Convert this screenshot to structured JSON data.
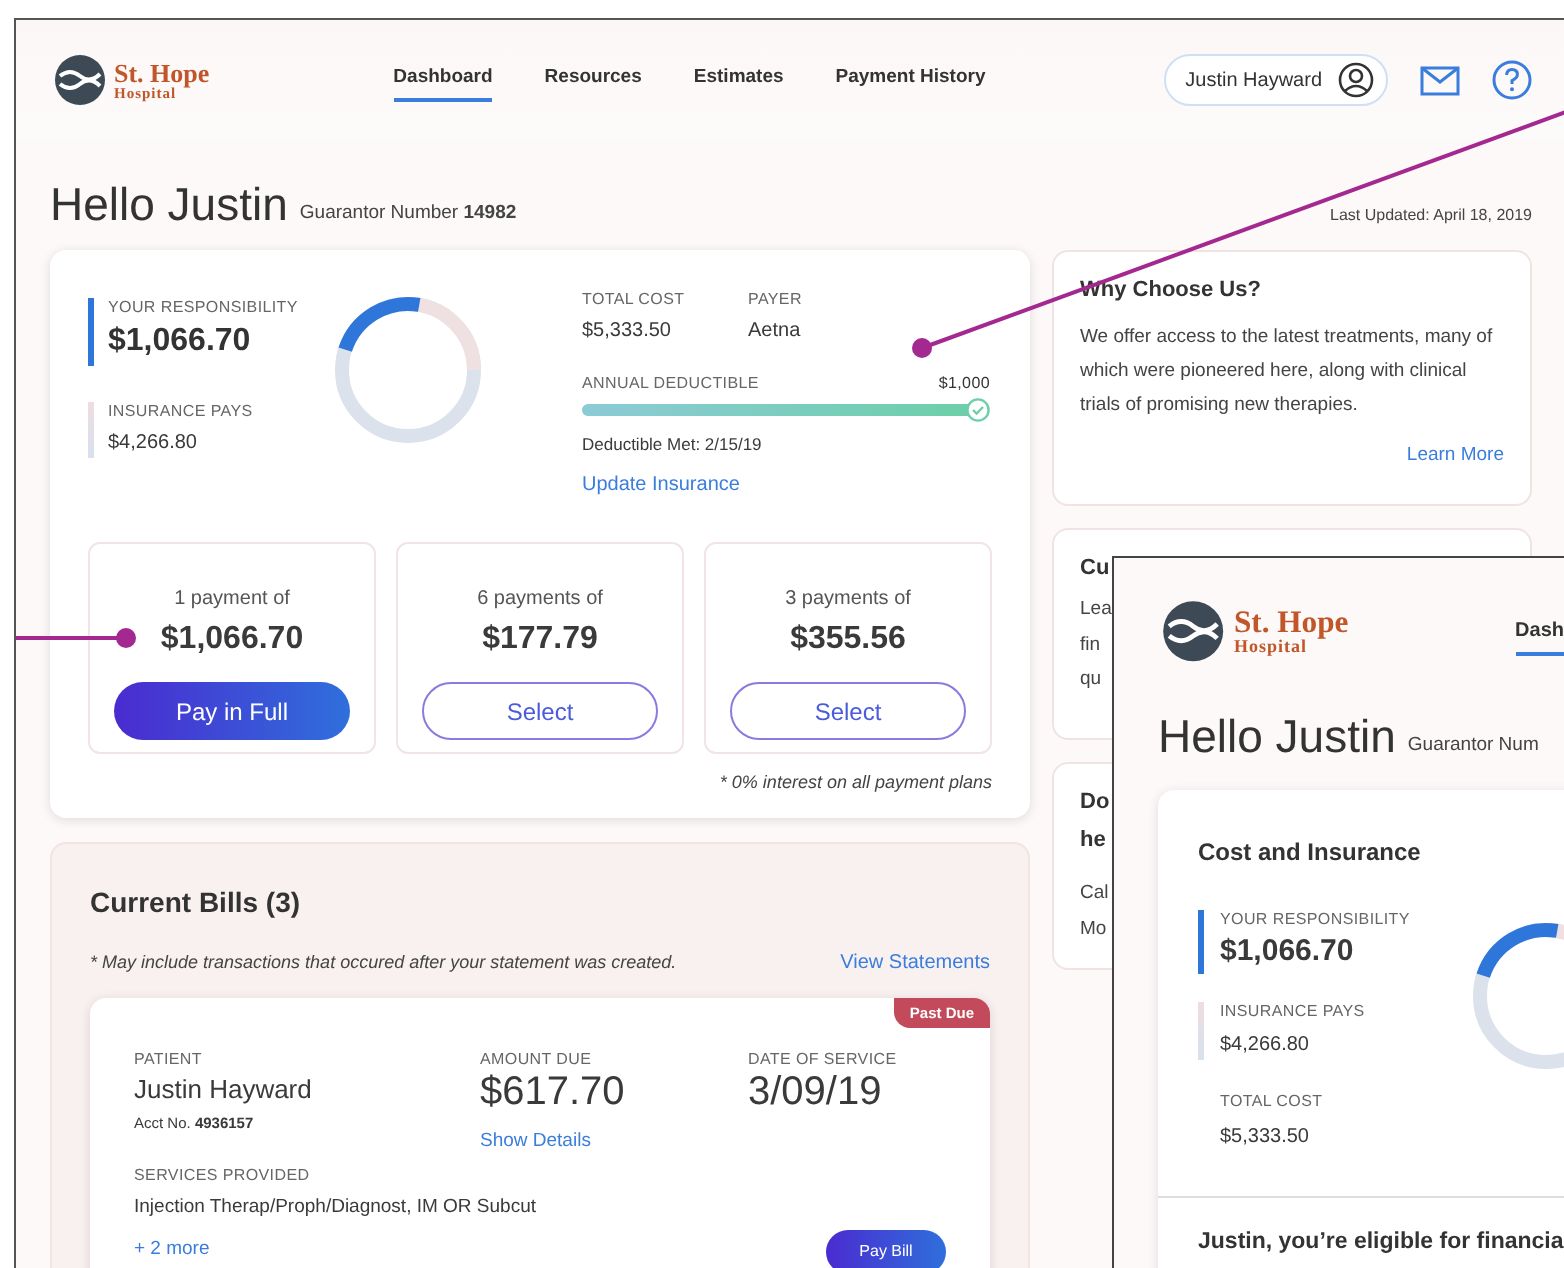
{
  "header": {
    "logo_name": "St. Hope",
    "logo_sub": "Hospital",
    "nav": [
      {
        "label": "Dashboard",
        "selected": true
      },
      {
        "label": "Resources",
        "selected": false
      },
      {
        "label": "Estimates",
        "selected": false
      },
      {
        "label": "Payment History",
        "selected": false
      }
    ],
    "user": "Justin Hayward"
  },
  "greeting": {
    "title": "Hello Justin",
    "guarantor": "Guarantor Number **14982**",
    "last_updated": "Last Updated: April 18, 2019"
  },
  "cost_summary": {
    "responsibility_label": "YOUR RESPONSIBILITY",
    "responsibility": "$1,066.70",
    "insurance_label": "INSURANCE PAYS",
    "insurance": "$4,266.80",
    "total_cost_label": "TOTAL COST",
    "total_cost": "$5,333.50",
    "payer_label": "PAYER",
    "payer": "Aetna",
    "deductible_label": "ANNUAL DEDUCTIBLE",
    "deductible_amount": "$1,000",
    "deductible": {
      "level": 1
    },
    "deductible_met": "Deductible Met: 2/15/19",
    "update_link": "Update Insurance"
  },
  "payment_options": [
    {
      "caption": "1 payment of",
      "amount": "$1,066.70",
      "button": "Pay in Full",
      "kind": "filled"
    },
    {
      "caption": "6 payments of",
      "amount": "$177.79",
      "button": "Select",
      "kind": "outline"
    },
    {
      "caption": "3 payments of",
      "amount": "$355.56",
      "button": "Select",
      "kind": "outline"
    }
  ],
  "payment_note": "* 0% interest on all payment plans",
  "bills": {
    "title": "Current Bills (3)",
    "note": "* May include transactions that occured after your statement was created.",
    "link": "View Statements",
    "items": [
      {
        "status": "Past Due",
        "patient_label": "PATIENT",
        "patient": "Justin Hayward",
        "account": "Acct No. **4936157**",
        "amount_label": "AMOUNT DUE",
        "amount": "$617.70",
        "details_link": "Show Details",
        "date_label": "DATE OF SERVICE",
        "date": "3/09/19",
        "services_label": "SERVICES PROVIDED",
        "services": "Injection Therap/Proph/Diagnost, IM OR Subcut",
        "more_link": "+ 2 more",
        "button": "Pay Bill"
      }
    ]
  },
  "side_cards": [
    {
      "title_lines": [
        "Why Choose Us?"
      ],
      "body": "We offer access to the latest treatments, many of which were pioneered here, along with clinical trials of promising new therapies.",
      "link": "Learn More"
    },
    {
      "title_lines": [
        "Cu"
      ],
      "body_lines": [
        "Lea",
        "fin",
        "qu"
      ]
    },
    {
      "title_lines": [
        "Do",
        "he"
      ],
      "body_lines": [
        "Cal",
        "Mo"
      ]
    }
  ],
  "mobile_preview": {
    "logo_name": "St. Hope",
    "logo_sub": "Hospital",
    "nav_label": "Dash",
    "title": "Hello Justin",
    "guarantor": "Guarantor Num",
    "card_title": "Cost and Insurance",
    "responsibility_label": "YOUR RESPONSIBILITY",
    "responsibility": "$1,066.70",
    "insurance_label": "INSURANCE PAYS",
    "insurance": "$4,266.80",
    "total_cost_label": "TOTAL COST",
    "total_cost": "$5,333.50",
    "eligibility": "Justin, you’re eligible for financia"
  }
}
